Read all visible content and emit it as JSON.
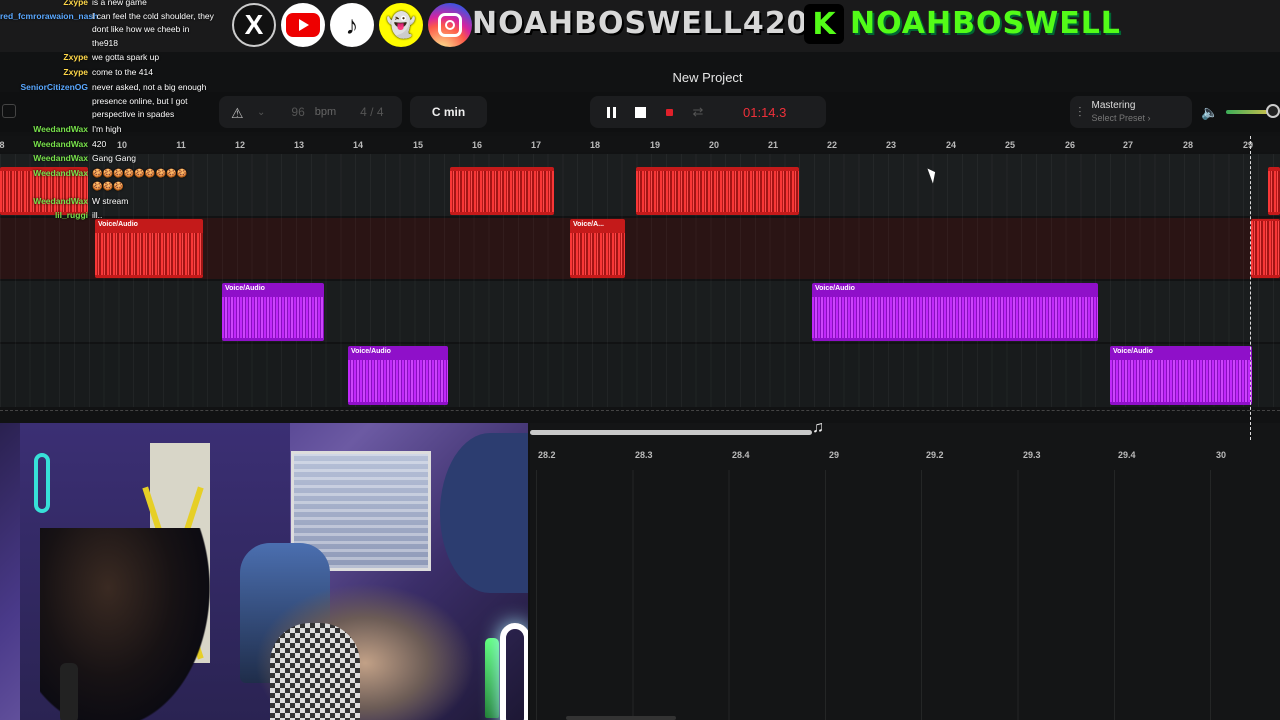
{
  "overlay": {
    "handle_main": "NOAHBOSWELL420",
    "kick_letter": "K",
    "handle_kick": "NOAHBOSWELL",
    "socials": [
      {
        "name": "x",
        "icon": "X"
      },
      {
        "name": "youtube",
        "icon": "youtube-play"
      },
      {
        "name": "tiktok",
        "icon": "♪"
      },
      {
        "name": "snapchat",
        "icon": "ghost"
      },
      {
        "name": "instagram",
        "icon": "camera"
      }
    ],
    "chat": [
      {
        "user": "Zxype",
        "text": "is a new game",
        "color": "yellow"
      },
      {
        "user": "red_fcmrorawaion_nash",
        "text": "I can feel the cold shoulder, they",
        "color": "blue"
      },
      {
        "user": "",
        "text": "dont like how we cheeb in",
        "color": "yellow"
      },
      {
        "user": "",
        "text": "the918",
        "color": "yellow"
      },
      {
        "user": "Zxype",
        "text": "we gotta spark up",
        "color": "yellow"
      },
      {
        "user": "Zxype",
        "text": "come to the 414",
        "color": "yellow"
      },
      {
        "user": "SeniorCitizenOG",
        "text": "never asked, not a big enough",
        "color": "blue"
      },
      {
        "user": "",
        "text": "presence online, but I got",
        "color": "blue"
      },
      {
        "user": "",
        "text": "perspective in spades",
        "color": "blue"
      },
      {
        "user": "WeedandWax",
        "text": "I'm high",
        "color": "green"
      },
      {
        "user": "WeedandWax",
        "text": "420",
        "color": "green"
      },
      {
        "user": "WeedandWax",
        "text": "Gang Gang",
        "color": "green"
      },
      {
        "user": "WeedandWax",
        "text": "🍪🍪🍪🍪🍪🍪🍪🍪🍪",
        "color": "green"
      },
      {
        "user": "",
        "text": "🍪🍪🍪",
        "color": "green"
      },
      {
        "user": "WeedandWax",
        "text": "W stream",
        "color": "green"
      },
      {
        "user": "lil_ruggi",
        "text": "ill..",
        "color": "green"
      }
    ]
  },
  "daw": {
    "project_title": "New Project",
    "toolbar": {
      "metronome_icon": "metronome-icon",
      "bpm_value": "96",
      "bpm_label": "bpm",
      "time_signature": "4 / 4",
      "key": "C min",
      "time": "01:14.3",
      "mastering_title": "Mastering",
      "mastering_preset": "Select Preset ›"
    },
    "ruler_ticks": [
      "8",
      "10",
      "11",
      "12",
      "13",
      "14",
      "15",
      "16",
      "17",
      "18",
      "19",
      "20",
      "21",
      "22",
      "23",
      "24",
      "25",
      "26",
      "27",
      "28",
      "29"
    ],
    "clip_label": "Voice/Audio",
    "clip_label_short": "Voice/A...",
    "colors": {
      "red_clip": "#c41a1a",
      "purple_clip": "#8f10c9",
      "time_red": "#f0303a",
      "accent_green": "#53fc18"
    },
    "editor_ruler": [
      "28.2",
      "28.3",
      "28.4",
      "29",
      "29.2",
      "29.3",
      "29.4",
      "30"
    ]
  }
}
